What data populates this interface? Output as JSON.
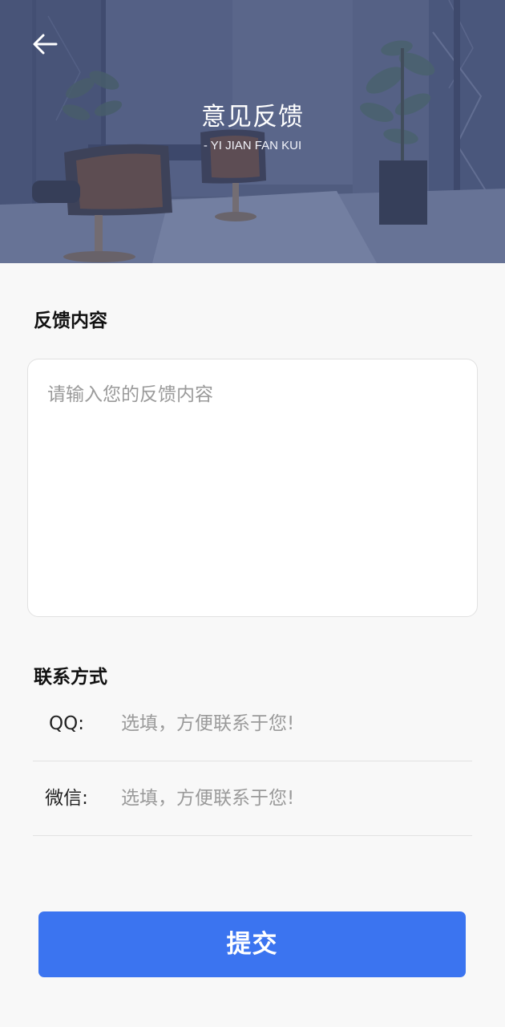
{
  "header": {
    "title": "意见反馈",
    "subtitle": "- YI JIAN FAN KUI",
    "back_icon": "arrow-left-icon"
  },
  "feedback": {
    "label": "反馈内容",
    "placeholder": "请输入您的反馈内容",
    "value": ""
  },
  "contact": {
    "label": "联系方式",
    "fields": [
      {
        "label": "QQ:",
        "placeholder": "选填，方便联系于您!",
        "value": ""
      },
      {
        "label": "微信:",
        "placeholder": "选填，方便联系于您!",
        "value": ""
      }
    ]
  },
  "submit": {
    "label": "提交"
  },
  "colors": {
    "primary": "#3b74f0",
    "page_background": "#f8f8f8",
    "hero_tint": "#55618a"
  }
}
